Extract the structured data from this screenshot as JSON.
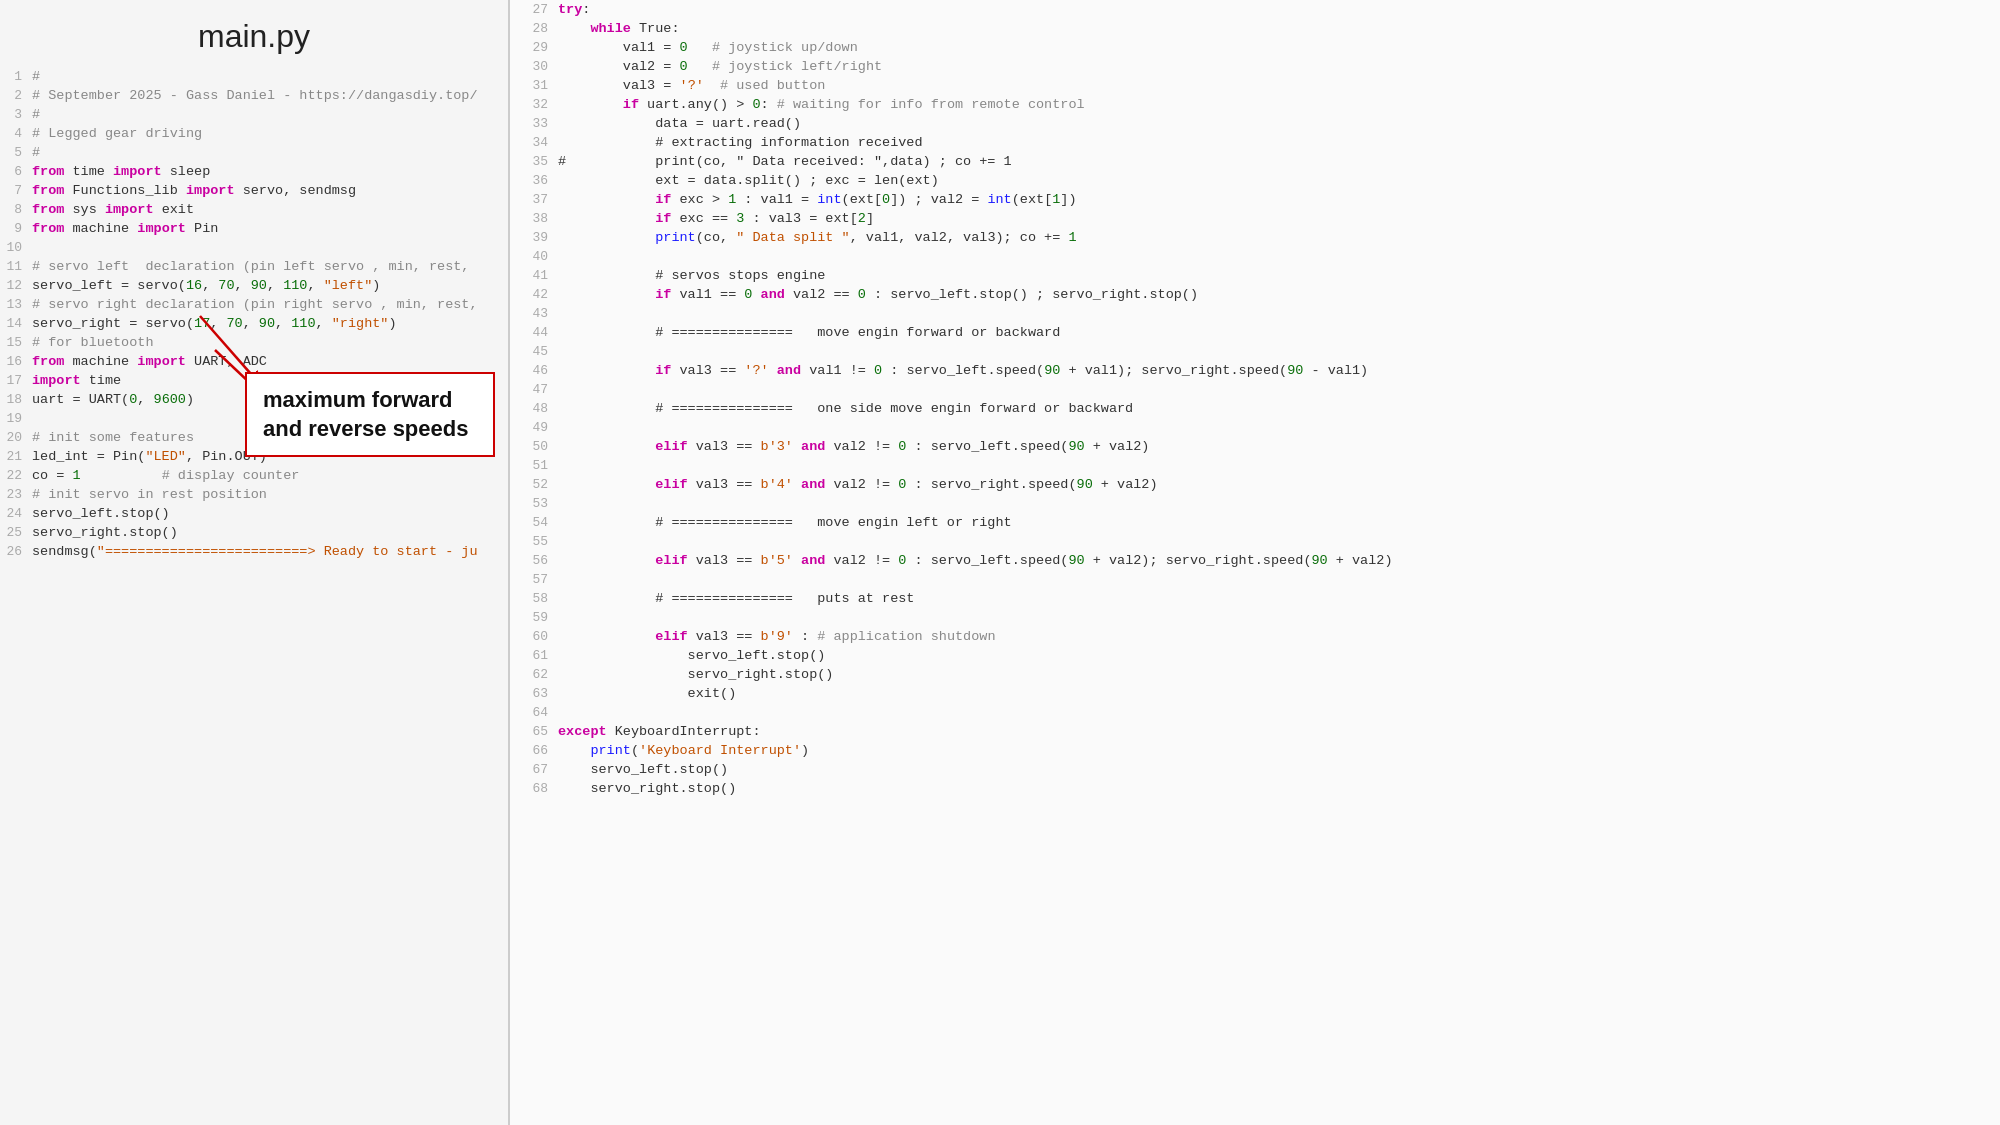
{
  "title": "main.py",
  "left_lines": [
    {
      "num": 1,
      "text": "#",
      "raw": true
    },
    {
      "num": 2,
      "text": "# September 2025 - Gass Daniel - https://dangasdiy.top/",
      "raw": true
    },
    {
      "num": 3,
      "text": "#",
      "raw": true
    },
    {
      "num": 4,
      "text": "# Legged gear driving",
      "raw": true
    },
    {
      "num": 5,
      "text": "#",
      "raw": true
    },
    {
      "num": 6,
      "text": "from time import sleep",
      "raw": true
    },
    {
      "num": 7,
      "text": "from Functions_lib import servo, sendmsg",
      "raw": true
    },
    {
      "num": 8,
      "text": "from sys import exit",
      "raw": true
    },
    {
      "num": 9,
      "text": "from machine import Pin",
      "raw": true
    },
    {
      "num": 10,
      "text": "",
      "raw": true
    },
    {
      "num": 11,
      "text": "# servo left  declaration (pin left servo , min, rest,",
      "raw": true
    },
    {
      "num": 12,
      "text": "servo_left = servo(16, 70, 90, 110, \"left\")",
      "raw": true
    },
    {
      "num": 13,
      "text": "# servo right declaration (pin right servo , min, rest,",
      "raw": true
    },
    {
      "num": 14,
      "text": "servo_right = servo(17, 70, 90, 110, \"right\")",
      "raw": true
    },
    {
      "num": 15,
      "text": "# for bluetooth",
      "raw": true
    },
    {
      "num": 16,
      "text": "from machine import UART, ADC",
      "raw": true
    },
    {
      "num": 17,
      "text": "import time",
      "raw": true
    },
    {
      "num": 18,
      "text": "uart = UART(0, 9600)",
      "raw": true
    },
    {
      "num": 19,
      "text": "",
      "raw": true
    },
    {
      "num": 20,
      "text": "# init some features",
      "raw": true
    },
    {
      "num": 21,
      "text": "led_int = Pin(\"LED\", Pin.OUT)",
      "raw": true
    },
    {
      "num": 22,
      "text": "co = 1          # display counter",
      "raw": true
    },
    {
      "num": 23,
      "text": "# init servo in rest position",
      "raw": true
    },
    {
      "num": 24,
      "text": "servo_left.stop()",
      "raw": true
    },
    {
      "num": 25,
      "text": "servo_right.stop()",
      "raw": true
    },
    {
      "num": 26,
      "text": "sendmsg(\"=========================> Ready to start - ju",
      "raw": true
    }
  ],
  "right_lines": [
    {
      "num": 27,
      "text": "try:",
      "raw": true
    },
    {
      "num": 28,
      "text": "    while True:",
      "raw": true
    },
    {
      "num": 29,
      "text": "        val1 = 0   # joystick up/down",
      "raw": true
    },
    {
      "num": 30,
      "text": "        val2 = 0   # joystick left/right",
      "raw": true
    },
    {
      "num": 31,
      "text": "        val3 = '?'  # used button",
      "raw": true
    },
    {
      "num": 32,
      "text": "        if uart.any() > 0: # waiting for info from remote control",
      "raw": true
    },
    {
      "num": 33,
      "text": "            data = uart.read()",
      "raw": true
    },
    {
      "num": 34,
      "text": "            # extracting information received",
      "raw": true
    },
    {
      "num": 35,
      "text": "#           print(co, \" Data received: \",data) ; co += 1",
      "raw": true
    },
    {
      "num": 36,
      "text": "            ext = data.split() ; exc = len(ext)",
      "raw": true
    },
    {
      "num": 37,
      "text": "            if exc > 1 : val1 = int(ext[0]) ; val2 = int(ext[1])",
      "raw": true
    },
    {
      "num": 38,
      "text": "            if exc == 3 : val3 = ext[2]",
      "raw": true
    },
    {
      "num": 39,
      "text": "            print(co, \" Data split \", val1, val2, val3); co += 1",
      "raw": true
    },
    {
      "num": 40,
      "text": "",
      "raw": true
    },
    {
      "num": 41,
      "text": "            # servos stops engine",
      "raw": true
    },
    {
      "num": 42,
      "text": "            if val1 == 0 and val2 == 0 : servo_left.stop() ; servo_right.stop()",
      "raw": true
    },
    {
      "num": 43,
      "text": "",
      "raw": true
    },
    {
      "num": 44,
      "text": "            # ===============   move engin forward or backward",
      "raw": true
    },
    {
      "num": 45,
      "text": "",
      "raw": true
    },
    {
      "num": 46,
      "text": "            if val3 == '?' and val1 != 0 : servo_left.speed(90 + val1); servo_right.speed(90 - val1)",
      "raw": true
    },
    {
      "num": 47,
      "text": "",
      "raw": true
    },
    {
      "num": 48,
      "text": "            # ===============   one side move engin forward or backward",
      "raw": true
    },
    {
      "num": 49,
      "text": "",
      "raw": true
    },
    {
      "num": 50,
      "text": "            elif val3 == b'3' and val2 != 0 : servo_left.speed(90 + val2)",
      "raw": true
    },
    {
      "num": 51,
      "text": "",
      "raw": true
    },
    {
      "num": 52,
      "text": "            elif val3 == b'4' and val2 != 0 : servo_right.speed(90 + val2)",
      "raw": true
    },
    {
      "num": 53,
      "text": "",
      "raw": true
    },
    {
      "num": 54,
      "text": "            # ===============   move engin left or right",
      "raw": true
    },
    {
      "num": 55,
      "text": "",
      "raw": true
    },
    {
      "num": 56,
      "text": "            elif val3 == b'5' and val2 != 0 : servo_left.speed(90 + val2); servo_right.speed(90 + val2)",
      "raw": true
    },
    {
      "num": 57,
      "text": "",
      "raw": true
    },
    {
      "num": 58,
      "text": "            # ===============   puts at rest",
      "raw": true
    },
    {
      "num": 59,
      "text": "",
      "raw": true
    },
    {
      "num": 60,
      "text": "            elif val3 == b'9' : # application shutdown",
      "raw": true
    },
    {
      "num": 61,
      "text": "                servo_left.stop()",
      "raw": true
    },
    {
      "num": 62,
      "text": "                servo_right.stop()",
      "raw": true
    },
    {
      "num": 63,
      "text": "                exit()",
      "raw": true
    },
    {
      "num": 64,
      "text": "",
      "raw": true
    },
    {
      "num": 65,
      "text": "except KeyboardInterrupt:",
      "raw": true
    },
    {
      "num": 66,
      "text": "    print('Keyboard Interrupt')",
      "raw": true
    },
    {
      "num": 67,
      "text": "    servo_left.stop()",
      "raw": true
    },
    {
      "num": 68,
      "text": "    servo_right.stop()",
      "raw": true
    }
  ],
  "annotation": {
    "text": "maximum forward\nand reverse speeds",
    "label": "CO"
  }
}
